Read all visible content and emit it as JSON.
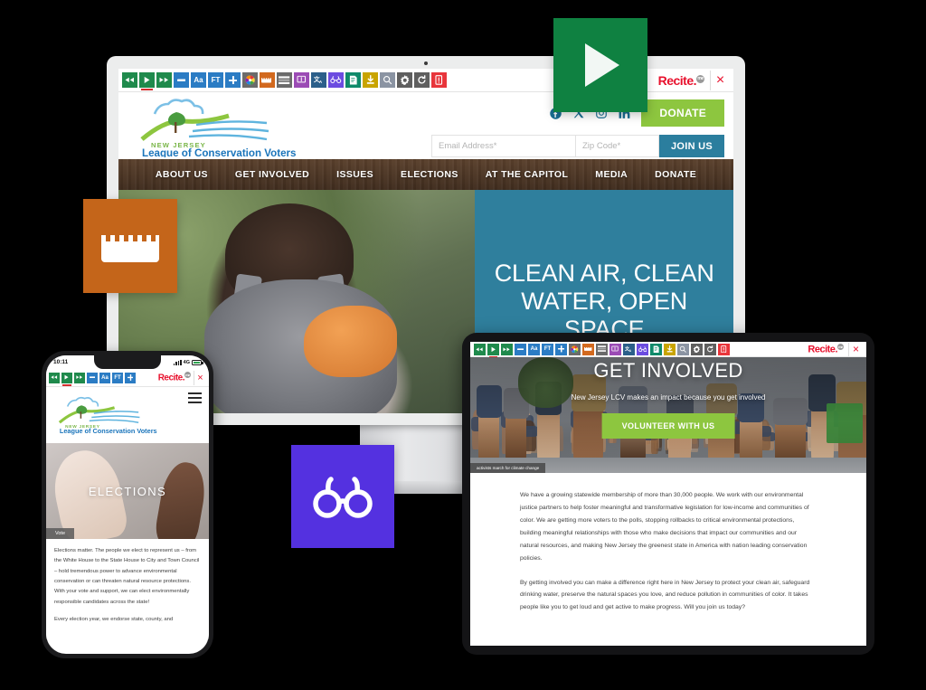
{
  "product": {
    "brand": "Recite",
    "brand_suffix": "me",
    "close_label": "×"
  },
  "toolbar": {
    "buttons": [
      {
        "name": "rewind-button",
        "label": "◀◀",
        "color": "#1f8a4c",
        "icon": "rewind-icon"
      },
      {
        "name": "play-button",
        "label": "▶",
        "color": "#1f8a4c",
        "icon": "play-icon",
        "active": true
      },
      {
        "name": "fast-forward-button",
        "label": "▶▶",
        "color": "#1f8a4c",
        "icon": "fast-forward-icon"
      },
      {
        "name": "decrease-text-button",
        "label": "−",
        "color": "#2b7cc4",
        "icon": "minus-icon"
      },
      {
        "name": "font-style-button",
        "label": "Aa",
        "color": "#2b7cc4",
        "icon": "font-icon"
      },
      {
        "name": "font-type-button",
        "label": "FT",
        "color": "#2b7cc4",
        "icon": "font-type-icon"
      },
      {
        "name": "increase-text-button",
        "label": "+",
        "color": "#2b7cc4",
        "icon": "plus-icon"
      },
      {
        "name": "color-theme-button",
        "label": "",
        "color": "#6b6b6b",
        "icon": "color-wheel-icon"
      },
      {
        "name": "ruler-button",
        "label": "",
        "color": "#d2691e",
        "icon": "ruler-icon"
      },
      {
        "name": "screen-mask-button",
        "label": "",
        "color": "#6b6b6b",
        "icon": "screen-mask-icon"
      },
      {
        "name": "dictionary-button",
        "label": "",
        "color": "#9b4bb5",
        "icon": "dictionary-icon"
      },
      {
        "name": "translate-button",
        "label": "",
        "color": "#2b5f8a",
        "icon": "translate-icon"
      },
      {
        "name": "magnifier-glasses-button",
        "label": "",
        "color": "#6c4ce0",
        "icon": "glasses-icon"
      },
      {
        "name": "plain-text-button",
        "label": "",
        "color": "#0f8a6a",
        "icon": "plain-text-icon"
      },
      {
        "name": "download-audio-button",
        "label": "",
        "color": "#c9a400",
        "icon": "download-icon"
      },
      {
        "name": "magnifier-button",
        "label": "",
        "color": "#8b94a3",
        "icon": "magnifier-icon"
      },
      {
        "name": "settings-button",
        "label": "",
        "color": "#5f5f5f",
        "icon": "gear-icon"
      },
      {
        "name": "reset-button",
        "label": "",
        "color": "#5f5f5f",
        "icon": "reset-icon"
      },
      {
        "name": "help-button",
        "label": "",
        "color": "#e8353b",
        "icon": "help-icon"
      }
    ]
  },
  "tiles": [
    {
      "name": "tile-play",
      "icon": "play-icon",
      "color": "#0f8141"
    },
    {
      "name": "tile-ruler",
      "icon": "ruler-icon",
      "color": "#c4651a"
    },
    {
      "name": "tile-glasses",
      "icon": "glasses-icon",
      "color": "#5431e0"
    }
  ],
  "desktop": {
    "site": {
      "logo_state": "NEW JERSEY",
      "logo_name": "League of Conservation Voters",
      "social": [
        {
          "name": "facebook-icon",
          "label": "Facebook"
        },
        {
          "name": "x-twitter-icon",
          "label": "X"
        },
        {
          "name": "instagram-icon",
          "label": "Instagram"
        },
        {
          "name": "linkedin-icon",
          "label": "LinkedIn"
        }
      ],
      "donate_label": "DONATE",
      "email_placeholder": "Email Address*",
      "zip_placeholder": "Zip Code*",
      "join_label": "JOIN US",
      "nav": [
        "ABOUT US",
        "GET INVOLVED",
        "ISSUES",
        "ELECTIONS",
        "AT THE CAPITOL",
        "MEDIA",
        "DONATE"
      ],
      "hero_line1": "CLEAN AIR, CLEAN",
      "hero_line2": "WATER, OPEN SPACE",
      "hero_panel_color": "#2f7f9d"
    }
  },
  "phone": {
    "status": {
      "time": "10:11",
      "network": "4G"
    },
    "logo_state": "NEW JERSEY",
    "logo_name": "League of Conservation Voters",
    "hero_title": "ELECTIONS",
    "hero_tag": "Vote",
    "paragraphs": [
      "Elections matter. The people we elect to represent us – from the White House to the State House to City and Town Council – hold tremendous power to advance environmental conservation or can threaten natural resource protections. With your vote and support, we can elect environmentally responsible candidates across the state!",
      "Every election year, we endorse state, county, and"
    ]
  },
  "tablet": {
    "hero_title": "GET INVOLVED",
    "hero_subtitle": "New Jersey LCV makes an impact because you get involved",
    "cta_label": "VOLUNTEER WITH US",
    "hero_tag": "activists march for climate change",
    "paragraphs": [
      "We have a growing statewide membership of more than 30,000 people. We work with our environmental justice partners to help foster meaningful and transformative legislation for low-income and communities of color. We are getting more voters to the polls, stopping rollbacks to critical environmental protections, building meaningful relationships with those who make decisions that impact our communities and our natural resources, and making New Jersey the greenest state in America with nation leading conservation policies.",
      "By getting involved you can make a difference right here in New Jersey to protect your clean air, safeguard drinking water, preserve the natural spaces you love, and reduce pollution in communities of color. It takes people like you to get loud and get active to make progress. Will you join us today?"
    ]
  }
}
